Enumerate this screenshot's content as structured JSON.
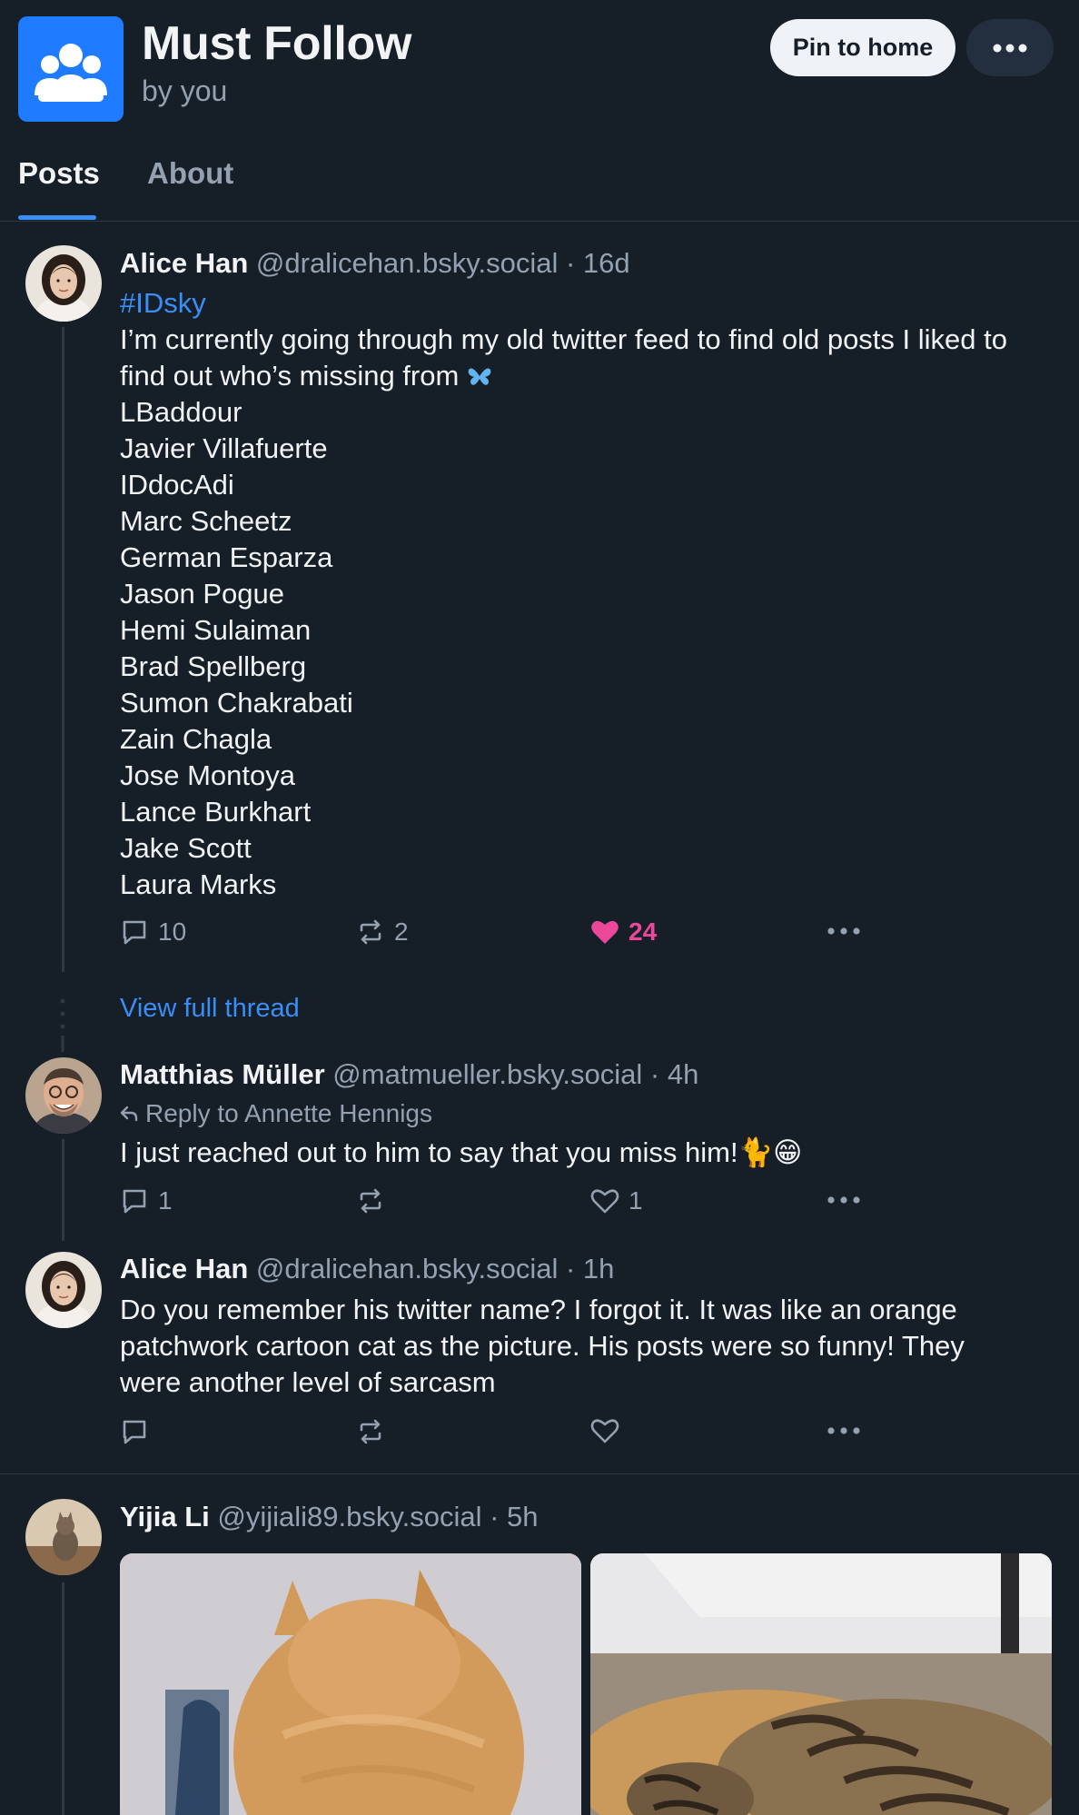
{
  "feed": {
    "title": "Must Follow",
    "byline": "by you",
    "pin_label": "Pin to home"
  },
  "tabs": [
    {
      "label": "Posts"
    },
    {
      "label": "About"
    }
  ],
  "posts": [
    {
      "name": "Alice Han",
      "handle": "@dralicehan.bsky.social",
      "time": "16d",
      "hashtag": "#IDsky",
      "text_intro": "I’m currently going through my old twitter feed to find old posts I liked to find out who’s missing from",
      "names_list": [
        "LBaddour",
        "Javier Villafuerte",
        "IDdocAdi",
        "Marc Scheetz",
        "German Esparza",
        "Jason Pogue",
        "Hemi Sulaiman",
        "Brad Spellberg",
        "Sumon Chakrabati",
        "Zain Chagla",
        "Jose Montoya",
        "Lance Burkhart",
        "Jake Scott",
        "Laura Marks"
      ],
      "replies": "10",
      "reposts": "2",
      "likes": "24"
    },
    {
      "view_thread": "View full thread"
    },
    {
      "name": "Matthias Müller",
      "handle": "@matmueller.bsky.social",
      "time": "4h",
      "reply_to": "Reply to Annette Hennigs",
      "text": "I just reached out to him to say that you miss him!🐈😁",
      "replies": "1",
      "likes": "1"
    },
    {
      "name": "Alice Han",
      "handle": "@dralicehan.bsky.social",
      "time": "1h",
      "text": "Do you remember his twitter name? I forgot it. It was like an orange patchwork cartoon cat as the picture. His posts were so funny! They were another level of sarcasm"
    },
    {
      "name": "Yijia Li",
      "handle": "@yijiali89.bsky.social",
      "time": "5h"
    }
  ],
  "separator": "·",
  "colors": {
    "background": "#161e27",
    "accent": "#3a8ef7",
    "like": "#ec4899",
    "muted": "#93a1b1"
  },
  "icons": [
    "people-icon",
    "ellipsis-icon",
    "comment-icon",
    "repost-icon",
    "heart-icon",
    "reply-arrow-icon",
    "butterfly-icon"
  ]
}
